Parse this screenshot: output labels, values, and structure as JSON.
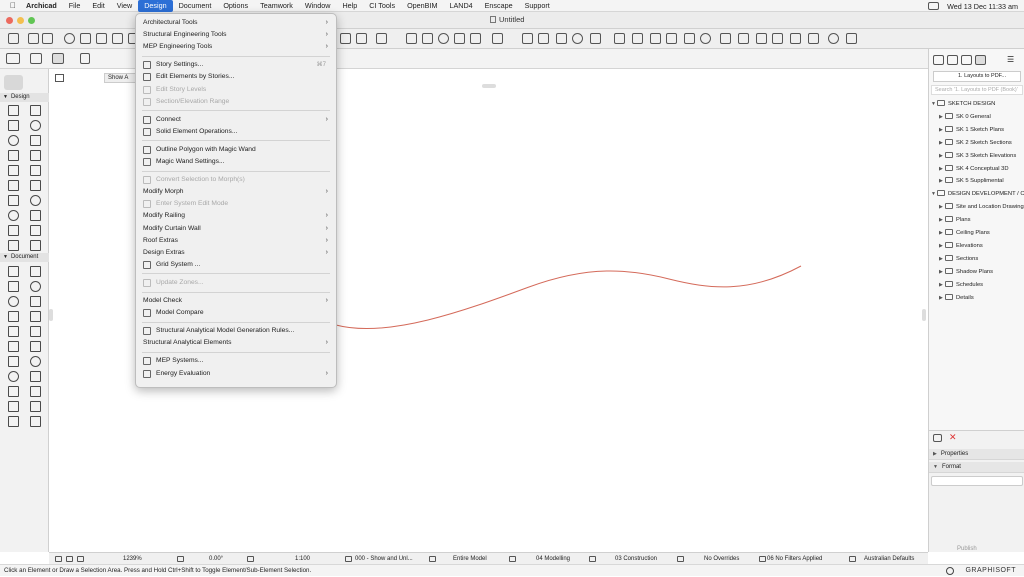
{
  "menubar": {
    "app": "Archicad",
    "items": [
      "File",
      "Edit",
      "View",
      "Design",
      "Document",
      "Options",
      "Teamwork",
      "Window",
      "Help",
      "CI Tools",
      "OpenBIM",
      "LAND4",
      "Enscape",
      "Support"
    ],
    "active": "Design",
    "clock": "Wed 13 Dec  11:33 am"
  },
  "window": {
    "title": "Untitled"
  },
  "toolbox": {
    "design_header": "Design",
    "document_header": "Document"
  },
  "view_tab": {
    "label": "Show A"
  },
  "navigator": {
    "selector": "1. Layouts to PDF...",
    "search_placeholder": "Search '1. Layouts to PDF (Book)'",
    "tree": [
      {
        "label": "SKETCH DESIGN",
        "level": 0
      },
      {
        "label": "SK 0 General",
        "level": 1
      },
      {
        "label": "SK 1 Sketch Plans",
        "level": 1
      },
      {
        "label": "SK 2 Sketch Sections",
        "level": 1
      },
      {
        "label": "SK 3 Sketch Elevations",
        "level": 1
      },
      {
        "label": "SK 4 Conceptual 3D",
        "level": 1
      },
      {
        "label": "SK 5 Supplimental",
        "level": 1
      },
      {
        "label": "DESIGN DEVELOPMENT / CO",
        "level": 0
      },
      {
        "label": "Site and Location Drawings",
        "level": 1
      },
      {
        "label": "Plans",
        "level": 1
      },
      {
        "label": "Ceiling Plans",
        "level": 1
      },
      {
        "label": "Elevations",
        "level": 1
      },
      {
        "label": "Sections",
        "level": 1
      },
      {
        "label": "Shadow Plans",
        "level": 1
      },
      {
        "label": "Schedules",
        "level": 1
      },
      {
        "label": "Details",
        "level": 1
      }
    ],
    "properties_label": "Properties",
    "format_label": "Format",
    "publish_label": "Publish"
  },
  "design_menu": [
    {
      "label": "Architectural Tools",
      "submenu": true
    },
    {
      "label": "Structural Engineering Tools",
      "submenu": true
    },
    {
      "label": "MEP Engineering Tools",
      "submenu": true
    },
    {
      "sep": true
    },
    {
      "label": "Story Settings...",
      "icon": true,
      "shortcut": "⌘7"
    },
    {
      "label": "Edit Elements by Stories...",
      "icon": true
    },
    {
      "label": "Edit Story Levels",
      "icon": true,
      "disabled": true
    },
    {
      "label": "Section/Elevation Range",
      "icon": true,
      "disabled": true
    },
    {
      "sep": true
    },
    {
      "label": "Connect",
      "icon": true,
      "submenu": true
    },
    {
      "label": "Solid Element Operations...",
      "icon": true
    },
    {
      "sep": true
    },
    {
      "label": "Outline Polygon with Magic Wand",
      "icon": true
    },
    {
      "label": "Magic Wand Settings...",
      "icon": true
    },
    {
      "sep": true
    },
    {
      "label": "Convert Selection to Morph(s)",
      "icon": true,
      "disabled": true
    },
    {
      "label": "Modify Morph",
      "submenu": true
    },
    {
      "label": "Enter System Edit Mode",
      "icon": true,
      "disabled": true
    },
    {
      "label": "Modify Railing",
      "submenu": true
    },
    {
      "label": "Modify Curtain Wall",
      "submenu": true
    },
    {
      "label": "Roof Extras",
      "submenu": true
    },
    {
      "label": "Design Extras",
      "submenu": true
    },
    {
      "label": "Grid System ...",
      "icon": true
    },
    {
      "sep": true
    },
    {
      "label": "Update Zones...",
      "icon": true,
      "disabled": true
    },
    {
      "sep": true
    },
    {
      "label": "Model Check",
      "submenu": true
    },
    {
      "label": "Model Compare",
      "icon": true
    },
    {
      "sep": true
    },
    {
      "label": "Structural Analytical Model Generation Rules...",
      "icon": true
    },
    {
      "label": "Structural Analytical Elements",
      "submenu": true
    },
    {
      "sep": true
    },
    {
      "label": "MEP Systems...",
      "icon": true
    },
    {
      "label": "Energy Evaluation",
      "icon": true,
      "submenu": true
    }
  ],
  "bottombar": {
    "zoom": "1239%",
    "angle": "0.00°",
    "scale": "1:100",
    "layers": "000 - Show and Unl...",
    "model": "Entire Model",
    "mvo": "04 Modelling",
    "pen": "03 Construction",
    "override": "No Overrides",
    "renovation": "06 No Filters Applied",
    "dimension": "Australian Defaults"
  },
  "status": {
    "hint": "Click an Element or Draw a Selection Area. Press and Hold Ctrl+Shift to Toggle Element/Sub-Element Selection.",
    "brand": "GRAPHISOFT"
  },
  "colors": {
    "curve": "#d46a5a",
    "menu_highlight": "#2c6fd6"
  }
}
